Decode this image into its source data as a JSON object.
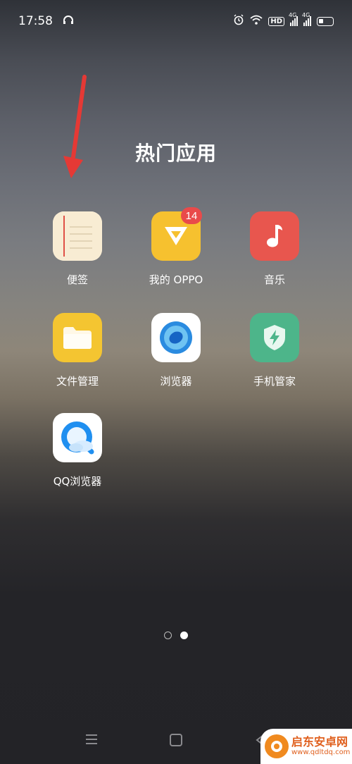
{
  "status_bar": {
    "time": "17:58",
    "signal_label_1": "4G",
    "signal_label_2": "4G",
    "hd_label": "HD"
  },
  "folder": {
    "title": "热门应用"
  },
  "apps": [
    {
      "label": "便签",
      "icon": "notes-icon",
      "color": "#f7ead0"
    },
    {
      "label": "我的 OPPO",
      "icon": "my-oppo-icon",
      "color": "#f6c12f",
      "badge": "14"
    },
    {
      "label": "音乐",
      "icon": "music-icon",
      "color": "#e8564e"
    },
    {
      "label": "文件管理",
      "icon": "folder-icon",
      "color": "#f4c531"
    },
    {
      "label": "浏览器",
      "icon": "browser-icon",
      "color": "#ffffff"
    },
    {
      "label": "手机管家",
      "icon": "shield-icon",
      "color": "#4db58a"
    },
    {
      "label": "QQ浏览器",
      "icon": "qq-browser-icon",
      "color": "#ffffff"
    }
  ],
  "page_indicator": {
    "total": 2,
    "current": 2
  },
  "watermark": {
    "name": "启东安卓网",
    "url": "www.qdltdq.com"
  },
  "colors": {
    "badge": "#e94a4a",
    "arrow": "#e53935"
  }
}
